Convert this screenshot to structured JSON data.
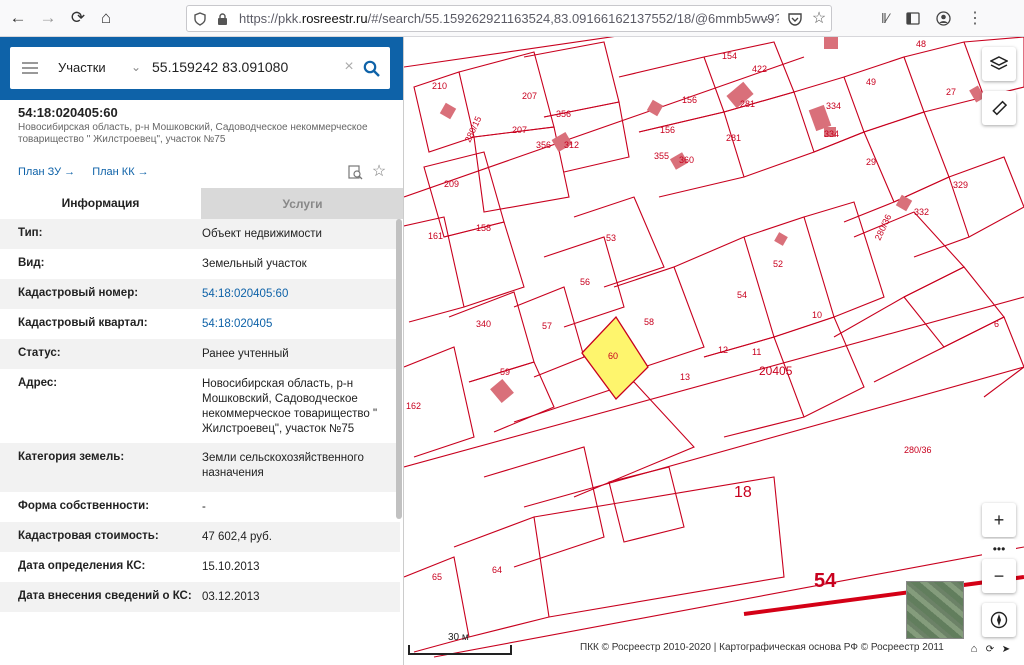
{
  "browser": {
    "url_prefix": "https://pkk.",
    "url_domain": "rosreestr.ru",
    "url_rest": "/#/search/55.159262921163524,83.09166162137552/18/@6mmb5wv9?"
  },
  "search": {
    "type_label": "Участки",
    "query": "55.159242 83.091080"
  },
  "object": {
    "title": "54:18:020405:60",
    "subtitle": "Новосибирская область, р-н Мошковский, Садоводческое некоммерческое товарищество \" Жилстроевец\", участок №75",
    "plan_zu": "План ЗУ",
    "plan_kk": "План КК"
  },
  "tabs": {
    "info": "Информация",
    "services": "Услуги"
  },
  "rows": [
    {
      "k": "Тип:",
      "v": "Объект недвижимости"
    },
    {
      "k": "Вид:",
      "v": "Земельный участок"
    },
    {
      "k": "Кадастровый номер:",
      "v": "54:18:020405:60"
    },
    {
      "k": "Кадастровый квартал:",
      "v": "54:18:020405"
    },
    {
      "k": "Статус:",
      "v": "Ранее учтенный"
    },
    {
      "k": "Адрес:",
      "v": "Новосибирская область, р-н Мошковский, Садоводческое некоммерческое товарищество \" Жилстроевец\", участок №75"
    },
    {
      "k": "Категория земель:",
      "v": "Земли сельскохозяйственного назначения"
    },
    {
      "k": "Форма собственности:",
      "v": "-"
    },
    {
      "k": "Кадастровая стоимость:",
      "v": "47 602,4 руб."
    },
    {
      "k": "Дата определения КС:",
      "v": "15.10.2013"
    },
    {
      "k": "Дата внесения сведений о КС:",
      "v": "03.12.2013"
    }
  ],
  "map": {
    "labels": [
      "210",
      "207",
      "207",
      "356",
      "356",
      "312",
      "154",
      "422",
      "156",
      "156",
      "281",
      "281",
      "355",
      "360",
      "48",
      "49",
      "27",
      "334",
      "334",
      "280/15",
      "209",
      "158",
      "161",
      "53",
      "56",
      "57",
      "340",
      "59",
      "58",
      "60",
      "12",
      "13",
      "11",
      "10",
      "54",
      "52",
      "29",
      "332",
      "329",
      "280/36",
      "6",
      "162",
      "20405",
      "280/36",
      "18",
      "54",
      "65",
      "64"
    ],
    "scale": "30 м",
    "attribution": "ПКК © Росреестр 2010-2020 | Картографическая основа РФ © Росреестр 2011",
    "highlight_color": "#fef56d",
    "line_color": "#c8001e"
  }
}
